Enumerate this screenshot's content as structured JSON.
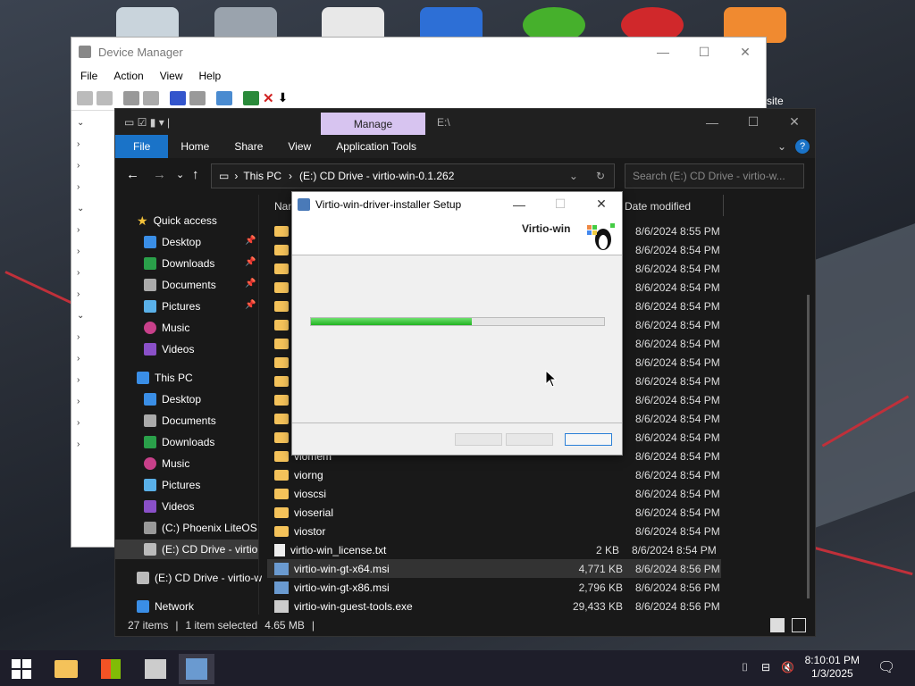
{
  "device_manager": {
    "title": "Device Manager",
    "menu": [
      "File",
      "Action",
      "View",
      "Help"
    ]
  },
  "explorer": {
    "title_tab": "Manage",
    "path_title": "E:\\",
    "ribbon_tabs": [
      "File",
      "Home",
      "Share",
      "View",
      "Application Tools"
    ],
    "address": {
      "seg1": "This PC",
      "seg2": "(E:) CD Drive - virtio-win-0.1.262"
    },
    "search_placeholder": "Search (E:) CD Drive - virtio-w...",
    "columns": {
      "name": "Name",
      "date": "Date modified"
    },
    "nav": {
      "quick_access": "Quick access",
      "quick_items": [
        "Desktop",
        "Downloads",
        "Documents",
        "Pictures",
        "Music",
        "Videos"
      ],
      "this_pc": "This PC",
      "pc_items": [
        "Desktop",
        "Documents",
        "Downloads",
        "Music",
        "Pictures",
        "Videos",
        "(C:) Phoenix LiteOS",
        "(E:) CD Drive - virtio"
      ],
      "cd_drive": "(E:) CD Drive - virtio-w",
      "network": "Network"
    },
    "files": [
      {
        "name": "",
        "size": "",
        "date": "8/6/2024 8:55 PM",
        "type": "folder"
      },
      {
        "name": "",
        "size": "",
        "date": "8/6/2024 8:54 PM",
        "type": "folder"
      },
      {
        "name": "",
        "size": "",
        "date": "8/6/2024 8:54 PM",
        "type": "folder"
      },
      {
        "name": "",
        "size": "",
        "date": "8/6/2024 8:54 PM",
        "type": "folder"
      },
      {
        "name": "",
        "size": "",
        "date": "8/6/2024 8:54 PM",
        "type": "folder"
      },
      {
        "name": "",
        "size": "",
        "date": "8/6/2024 8:54 PM",
        "type": "folder"
      },
      {
        "name": "",
        "size": "",
        "date": "8/6/2024 8:54 PM",
        "type": "folder"
      },
      {
        "name": "",
        "size": "",
        "date": "8/6/2024 8:54 PM",
        "type": "folder"
      },
      {
        "name": "",
        "size": "",
        "date": "8/6/2024 8:54 PM",
        "type": "folder"
      },
      {
        "name": "",
        "size": "",
        "date": "8/6/2024 8:54 PM",
        "type": "folder"
      },
      {
        "name": "",
        "size": "",
        "date": "8/6/2024 8:54 PM",
        "type": "folder"
      },
      {
        "name": "",
        "size": "",
        "date": "8/6/2024 8:54 PM",
        "type": "folder"
      },
      {
        "name": "viomem",
        "size": "",
        "date": "8/6/2024 8:54 PM",
        "type": "folder"
      },
      {
        "name": "viorng",
        "size": "",
        "date": "8/6/2024 8:54 PM",
        "type": "folder"
      },
      {
        "name": "vioscsi",
        "size": "",
        "date": "8/6/2024 8:54 PM",
        "type": "folder"
      },
      {
        "name": "vioserial",
        "size": "",
        "date": "8/6/2024 8:54 PM",
        "type": "folder"
      },
      {
        "name": "viostor",
        "size": "",
        "date": "8/6/2024 8:54 PM",
        "type": "folder"
      },
      {
        "name": "virtio-win_license.txt",
        "size": "2 KB",
        "date": "8/6/2024 8:54 PM",
        "type": "txt"
      },
      {
        "name": "virtio-win-gt-x64.msi",
        "size": "4,771 KB",
        "date": "8/6/2024 8:56 PM",
        "type": "msi"
      },
      {
        "name": "virtio-win-gt-x86.msi",
        "size": "2,796 KB",
        "date": "8/6/2024 8:56 PM",
        "type": "msi"
      },
      {
        "name": "virtio-win-guest-tools.exe",
        "size": "29,433 KB",
        "date": "8/6/2024 8:56 PM",
        "type": "exe"
      }
    ],
    "status": {
      "items": "27 items",
      "selected": "1 item selected",
      "size": "4.65 MB"
    }
  },
  "setup": {
    "title": "Virtio-win-driver-installer Setup",
    "brand": "Virtio-win",
    "progress": 0.55
  },
  "taskbar": {
    "time": "8:10:01 PM",
    "date": "1/3/2025"
  },
  "desktop": {
    "partial_label": "site"
  },
  "colors": {
    "accent": "#1a73c8",
    "manage_tab": "#d7c4f0",
    "progress": "#22b322"
  }
}
